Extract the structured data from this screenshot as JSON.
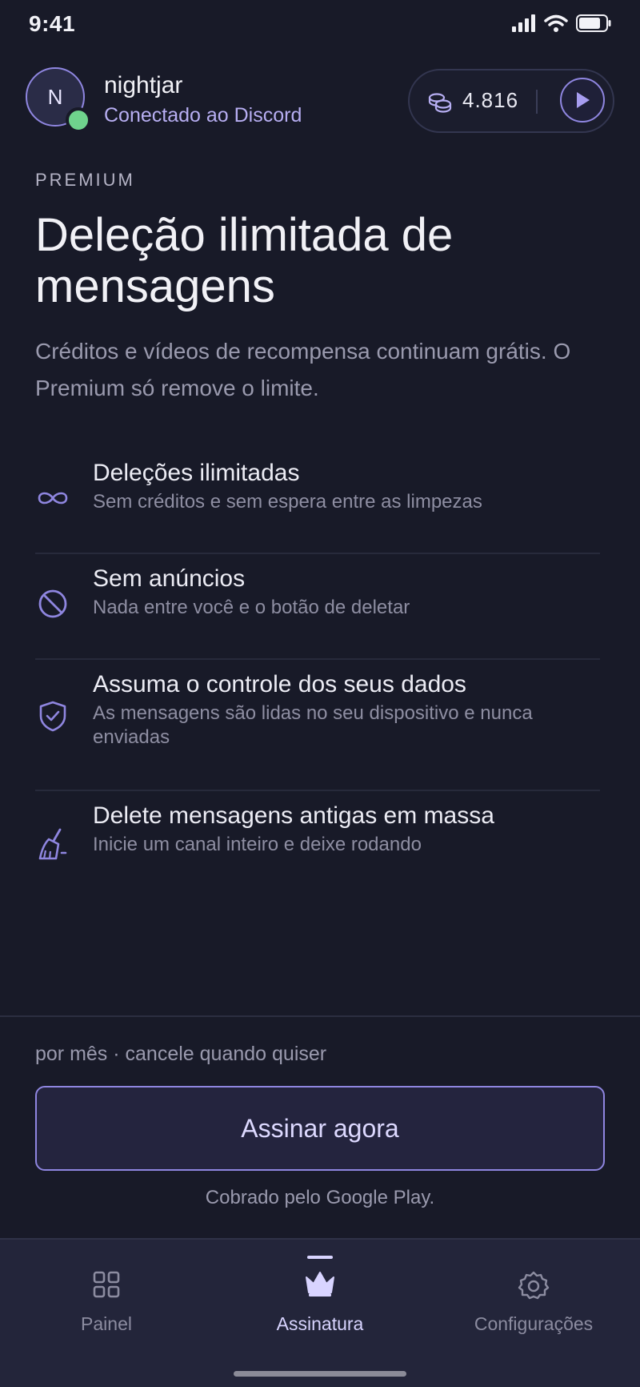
{
  "status_bar": {
    "time": "9:41"
  },
  "header": {
    "avatar_initial": "N",
    "username": "nightjar",
    "connection_status": "Conectado ao Discord",
    "credits": "4.816"
  },
  "hero": {
    "eyebrow": "PREMIUM",
    "title": "Deleção ilimitada de mensagens",
    "subtitle": "Créditos e vídeos de recompensa continuam grátis. O Premium só remove o limite."
  },
  "features": [
    {
      "icon": "infinity-icon",
      "title": "Deleções ilimitadas",
      "description": "Sem créditos e sem espera entre as limpezas"
    },
    {
      "icon": "no-ads-icon",
      "title": "Sem anúncios",
      "description": "Nada entre você e o botão de deletar"
    },
    {
      "icon": "shield-check-icon",
      "title": "Assuma o controle dos seus dados",
      "description": "As mensagens são lidas no seu dispositivo e nunca enviadas"
    },
    {
      "icon": "broom-icon",
      "title": "Delete mensagens antigas em massa",
      "description": "Inicie um canal inteiro e deixe rodando"
    }
  ],
  "purchase": {
    "price_note": "por mês · cancele quando quiser",
    "subscribe_label": "Assinar agora",
    "billing_note": "Cobrado pelo Google Play."
  },
  "tabs": [
    {
      "icon": "grid-icon",
      "label": "Painel",
      "active": false
    },
    {
      "icon": "crown-icon",
      "label": "Assinatura",
      "active": true
    },
    {
      "icon": "gear-icon",
      "label": "Configurações",
      "active": false
    }
  ],
  "colors": {
    "background": "#181a28",
    "accent": "#8f86e0",
    "online": "#6fd38d",
    "tabbar": "#23253a"
  }
}
